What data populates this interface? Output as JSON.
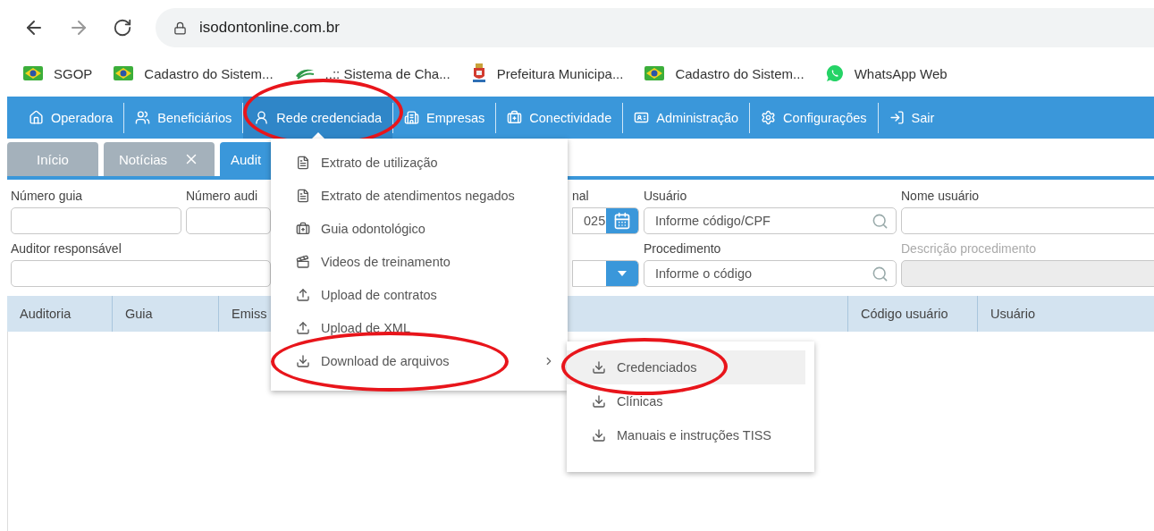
{
  "browser": {
    "url": "isodontonline.com.br"
  },
  "bookmarks": [
    {
      "label": "SGOP",
      "kind": "flag"
    },
    {
      "label": "Cadastro do Sistem...",
      "kind": "flag"
    },
    {
      "label": "..:: Sistema de Cha...",
      "kind": "swoosh"
    },
    {
      "label": "Prefeitura Municipa...",
      "kind": "crest"
    },
    {
      "label": "Cadastro do Sistem...",
      "kind": "flag"
    },
    {
      "label": "WhatsApp Web",
      "kind": "chat"
    }
  ],
  "nav": [
    {
      "label": "Operadora",
      "selected": false,
      "circled": false
    },
    {
      "label": "Beneficiários",
      "selected": false,
      "circled": false
    },
    {
      "label": "Rede credenciada",
      "selected": true,
      "circled": true
    },
    {
      "label": "Empresas",
      "selected": false,
      "circled": false
    },
    {
      "label": "Conectividade",
      "selected": false,
      "circled": false
    },
    {
      "label": "Administração",
      "selected": false,
      "circled": false
    },
    {
      "label": "Configurações",
      "selected": false,
      "circled": false
    },
    {
      "label": "Sair",
      "selected": false,
      "circled": false
    }
  ],
  "tabs": [
    {
      "label": "Início",
      "selected": false,
      "closable": false
    },
    {
      "label": "Notícias",
      "selected": false,
      "closable": true
    },
    {
      "label": "Audit",
      "selected": true,
      "closable": false
    }
  ],
  "filters": [
    [
      {
        "label": "Número guia",
        "kind": "text",
        "disabled": false
      },
      {
        "label": "Número audi",
        "kind": "text",
        "disabled": false
      },
      {
        "label": "nal",
        "kind": "date",
        "value": "025",
        "disabled": false
      },
      {
        "label": "Usuário",
        "kind": "search",
        "placeholder": "Informe código/CPF",
        "disabled": false
      },
      {
        "label": "Nome usuário",
        "kind": "text",
        "disabled": false
      }
    ],
    [
      {
        "label": "Auditor responsável",
        "kind": "text",
        "disabled": false
      },
      {
        "kind": "select",
        "disabled": false
      },
      {
        "label": "Procedimento",
        "kind": "search",
        "placeholder": "Informe o código",
        "disabled": false
      },
      {
        "label": "Descrição procedimento",
        "kind": "text",
        "disabled": true
      }
    ]
  ],
  "table": {
    "columns": [
      "Auditoria",
      "Guia",
      "Emiss",
      "Código usuário",
      "Usuário"
    ]
  },
  "menu": {
    "items": [
      {
        "label": "Extrato de utilização",
        "circled": false,
        "has_submenu": false
      },
      {
        "label": "Extrato de atendimentos negados",
        "circled": false,
        "has_submenu": false
      },
      {
        "label": "Guia odontológico",
        "circled": false,
        "has_submenu": false
      },
      {
        "label": "Videos de treinamento",
        "circled": false,
        "has_submenu": false
      },
      {
        "label": "Upload de contratos",
        "circled": false,
        "has_submenu": false
      },
      {
        "label": "Upload de XML",
        "circled": false,
        "has_submenu": false
      },
      {
        "label": "Download de arquivos",
        "circled": true,
        "has_submenu": true,
        "expanded": true
      }
    ]
  },
  "submenu": {
    "items": [
      {
        "label": "Credenciados",
        "selected": true,
        "circled": true
      },
      {
        "label": "Clínicas",
        "selected": false,
        "circled": false
      },
      {
        "label": "Manuais e instruções TISS",
        "selected": false,
        "circled": false
      }
    ]
  }
}
